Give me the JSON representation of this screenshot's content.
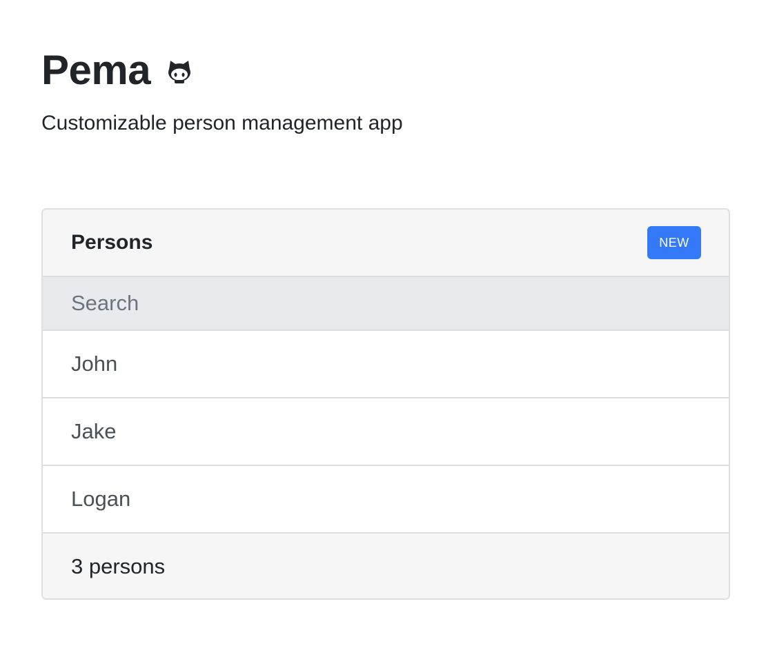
{
  "header": {
    "title": "Pema",
    "github_icon": "github-octocat-icon",
    "subtitle": "Customizable person management app"
  },
  "card": {
    "title": "Persons",
    "new_button_label": "NEW",
    "search": {
      "placeholder": "Search",
      "value": ""
    },
    "persons": [
      {
        "name": "John"
      },
      {
        "name": "Jake"
      },
      {
        "name": "Logan"
      }
    ],
    "footer_text": "3 persons"
  },
  "colors": {
    "accent": "#3479f7",
    "text": "#212529",
    "muted_text": "#495057",
    "header_bg": "#f6f6f6",
    "search_bg": "#e9eaee",
    "border": "#dcdcdc"
  }
}
